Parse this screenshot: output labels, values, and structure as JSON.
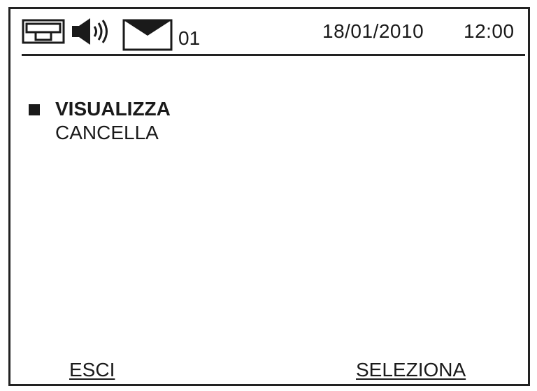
{
  "status_bar": {
    "icons": [
      "intercom-icon",
      "speaker-icon",
      "envelope-icon"
    ],
    "message_count": "01",
    "date": "18/01/2010",
    "time": "12:00"
  },
  "menu": {
    "selected_index": 0,
    "items": [
      {
        "label": "VISUALIZZA"
      },
      {
        "label": "CANCELLA"
      }
    ]
  },
  "softkeys": {
    "left_label": "ESCI",
    "right_label": "SELEZIONA"
  }
}
